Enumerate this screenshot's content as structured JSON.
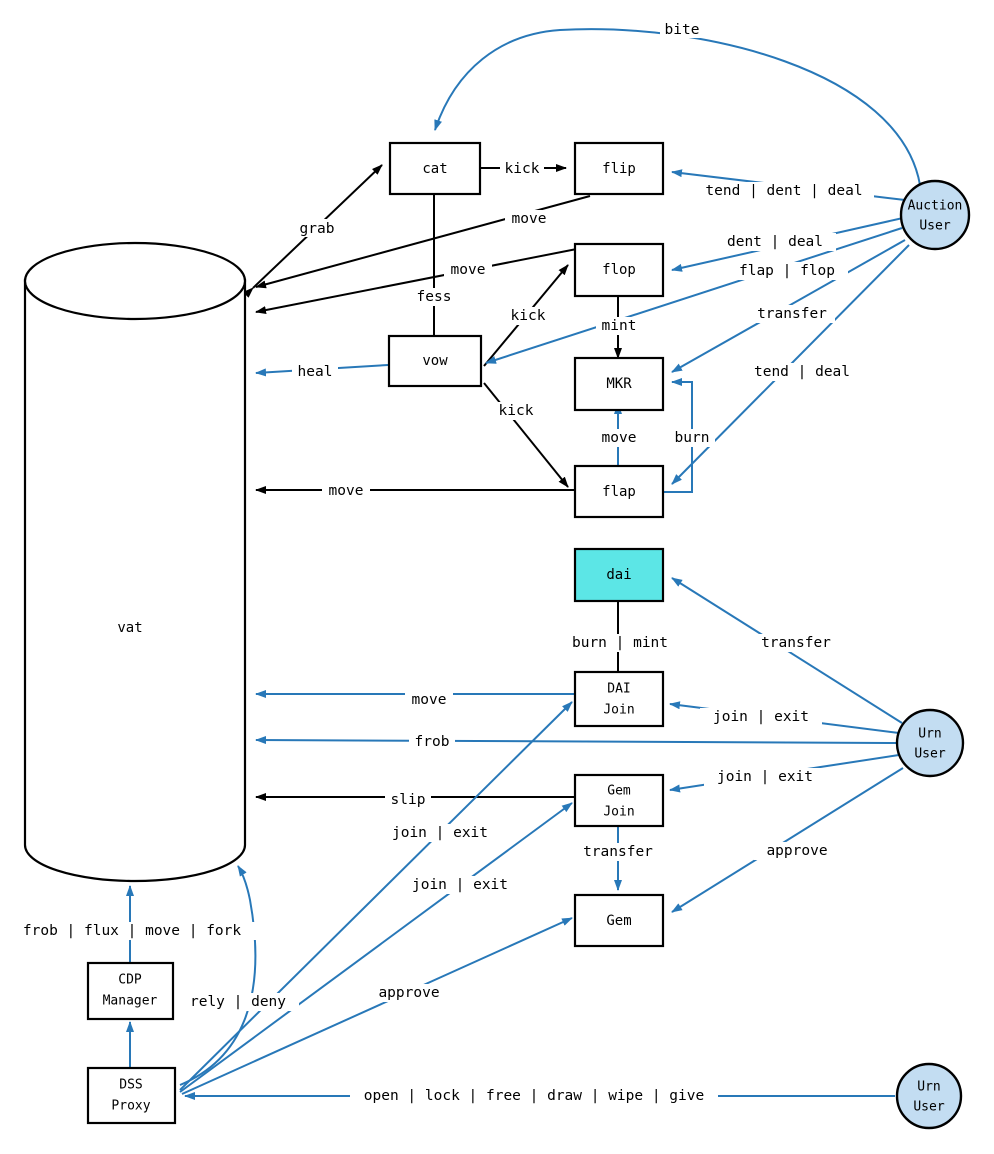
{
  "diagram": {
    "title": "DSS (MakerDAO) contract interaction diagram",
    "colors": {
      "black_edge": "#000000",
      "blue_edge": "#2878b8",
      "actor_fill": "#c3ddf2",
      "highlight_fill": "#5ce6e6",
      "node_fill": "#ffffff",
      "background": "#ffffff"
    },
    "nodes": [
      {
        "id": "vat",
        "label": "vat",
        "shape": "cylinder"
      },
      {
        "id": "cat",
        "label": "cat",
        "shape": "box"
      },
      {
        "id": "flip",
        "label": "flip",
        "shape": "box"
      },
      {
        "id": "flop",
        "label": "flop",
        "shape": "box"
      },
      {
        "id": "vow",
        "label": "vow",
        "shape": "box"
      },
      {
        "id": "mkr",
        "label": "MKR",
        "shape": "box"
      },
      {
        "id": "flap",
        "label": "flap",
        "shape": "box"
      },
      {
        "id": "dai",
        "label": "dai",
        "shape": "box",
        "highlight": true
      },
      {
        "id": "daijoin",
        "label": "DAI\nJoin",
        "line1": "DAI",
        "line2": "Join",
        "shape": "box"
      },
      {
        "id": "gemjoin",
        "label": "Gem\nJoin",
        "line1": "Gem",
        "line2": "Join",
        "shape": "box"
      },
      {
        "id": "gem",
        "label": "Gem",
        "shape": "box"
      },
      {
        "id": "cdpmanager",
        "label": "CDP\nManager",
        "line1": "CDP",
        "line2": "Manager",
        "shape": "box"
      },
      {
        "id": "dssproxy",
        "label": "DSS\nProxy",
        "line1": "DSS",
        "line2": "Proxy",
        "shape": "box"
      },
      {
        "id": "auctionuser",
        "label": "Auction\nUser",
        "line1": "Auction",
        "line2": "User",
        "shape": "circle"
      },
      {
        "id": "urnuser1",
        "label": "Urn\nUser",
        "line1": "Urn",
        "line2": "User",
        "shape": "circle"
      },
      {
        "id": "urnuser2",
        "label": "Urn\nUser",
        "line1": "Urn",
        "line2": "User",
        "shape": "circle"
      }
    ],
    "edges": [
      {
        "id": "e-bite",
        "from": "auctionuser",
        "to": "cat",
        "label": "bite",
        "color": "blue"
      },
      {
        "id": "e-grab",
        "from": "vat",
        "to": "cat",
        "label": "grab",
        "color": "black"
      },
      {
        "id": "e-cat-kick-flip",
        "from": "cat",
        "to": "flip",
        "label": "kick",
        "color": "black"
      },
      {
        "id": "e-flip-move",
        "from": "flip",
        "to": "vat",
        "label": "move",
        "color": "black"
      },
      {
        "id": "e-flop-move",
        "from": "flop",
        "to": "vat",
        "label": "move",
        "color": "black"
      },
      {
        "id": "e-fess",
        "from": "cat",
        "to": "vow",
        "label": "fess",
        "color": "black"
      },
      {
        "id": "e-vow-kick-flop",
        "from": "vow",
        "to": "flop",
        "label": "kick",
        "color": "black"
      },
      {
        "id": "e-vow-kick-flap",
        "from": "vow",
        "to": "flap",
        "label": "kick",
        "color": "black"
      },
      {
        "id": "e-heal",
        "from": "vow",
        "to": "vat",
        "label": "heal",
        "color": "blue"
      },
      {
        "id": "e-flop-mint",
        "from": "flop",
        "to": "mkr",
        "label": "mint",
        "color": "black"
      },
      {
        "id": "e-flap-move",
        "from": "flap",
        "to": "mkr",
        "label": "move",
        "color": "blue"
      },
      {
        "id": "e-flap-vat-move",
        "from": "flap",
        "to": "vat",
        "label": "move",
        "color": "black"
      },
      {
        "id": "e-burn",
        "from": "flap",
        "to": "mkr",
        "label": "burn",
        "color": "blue"
      },
      {
        "id": "e-flip-tdd",
        "from": "auctionuser",
        "to": "flip",
        "label": "tend | dent | deal",
        "color": "blue"
      },
      {
        "id": "e-flop-dd",
        "from": "auctionuser",
        "to": "flop",
        "label": "dent | deal",
        "color": "blue"
      },
      {
        "id": "e-vow-flapflop",
        "from": "auctionuser",
        "to": "vow",
        "label": "flap | flop",
        "color": "blue"
      },
      {
        "id": "e-mkr-transfer",
        "from": "auctionuser",
        "to": "mkr",
        "label": "transfer",
        "color": "blue"
      },
      {
        "id": "e-flap-td",
        "from": "auctionuser",
        "to": "flap",
        "label": "tend | deal",
        "color": "blue"
      },
      {
        "id": "e-dai-burnmint",
        "from": "dai",
        "to": "daijoin",
        "label": "burn | mint",
        "color": "black"
      },
      {
        "id": "e-dai-transfer",
        "from": "urnuser1",
        "to": "dai",
        "label": "transfer",
        "color": "blue"
      },
      {
        "id": "e-daijoin-move",
        "from": "daijoin",
        "to": "vat",
        "label": "move",
        "color": "blue"
      },
      {
        "id": "e-frob",
        "from": "urnuser1",
        "to": "vat",
        "label": "frob",
        "color": "blue"
      },
      {
        "id": "e-daijoin-je",
        "from": "urnuser1",
        "to": "daijoin",
        "label": "join | exit",
        "color": "blue"
      },
      {
        "id": "e-slip",
        "from": "gemjoin",
        "to": "vat",
        "label": "slip",
        "color": "black"
      },
      {
        "id": "e-gemjoin-je",
        "from": "urnuser1",
        "to": "gemjoin",
        "label": "join | exit",
        "color": "blue"
      },
      {
        "id": "e-gemjoin-xfer",
        "from": "gemjoin",
        "to": "gem",
        "label": "transfer",
        "color": "blue"
      },
      {
        "id": "e-gem-approve",
        "from": "urnuser1",
        "to": "gem",
        "label": "approve",
        "color": "blue"
      },
      {
        "id": "e-proxy-daijoin",
        "from": "dssproxy",
        "to": "daijoin",
        "label": "join | exit",
        "color": "blue"
      },
      {
        "id": "e-proxy-gemjoin",
        "from": "dssproxy",
        "to": "gemjoin",
        "label": "join | exit",
        "color": "blue"
      },
      {
        "id": "e-proxy-gem",
        "from": "dssproxy",
        "to": "gem",
        "label": "approve",
        "color": "blue"
      },
      {
        "id": "e-cdp-vat",
        "from": "cdpmanager",
        "to": "vat",
        "label": "frob | flux | move | fork",
        "color": "blue"
      },
      {
        "id": "e-proxy-cdp",
        "from": "dssproxy",
        "to": "cdpmanager",
        "label": "",
        "color": "blue"
      },
      {
        "id": "e-relydeny",
        "from": "dssproxy",
        "to": "vat",
        "label": "rely | deny",
        "color": "blue"
      },
      {
        "id": "e-proxy-open",
        "from": "urnuser2",
        "to": "dssproxy",
        "label": "open | lock | free | draw | wipe | give",
        "color": "blue"
      }
    ],
    "labels": {
      "bite": "bite",
      "grab": "grab",
      "kick": "kick",
      "move": "move",
      "fess": "fess",
      "heal": "heal",
      "mint": "mint",
      "burn": "burn",
      "slip": "slip",
      "frob": "frob",
      "transfer": "transfer",
      "approve": "approve",
      "tend_dent_deal": "tend | dent | deal",
      "dent_deal": "dent | deal",
      "flap_flop": "flap | flop",
      "tend_deal": "tend | deal",
      "burn_mint": "burn | mint",
      "join_exit": "join | exit",
      "rely_deny": "rely | deny",
      "frob_flux_move_fork": "frob | flux | move | fork",
      "open_lock_free_draw_wipe_give": "open | lock | free | draw | wipe | give"
    },
    "node_text": {
      "vat": "vat",
      "cat": "cat",
      "flip": "flip",
      "flop": "flop",
      "vow": "vow",
      "mkr": "MKR",
      "flap": "flap",
      "dai": "dai",
      "daijoin_l1": "DAI",
      "daijoin_l2": "Join",
      "gemjoin_l1": "Gem",
      "gemjoin_l2": "Join",
      "gem": "Gem",
      "cdp_l1": "CDP",
      "cdp_l2": "Manager",
      "proxy_l1": "DSS",
      "proxy_l2": "Proxy",
      "auction_l1": "Auction",
      "auction_l2": "User",
      "urn_l1": "Urn",
      "urn_l2": "User"
    }
  }
}
